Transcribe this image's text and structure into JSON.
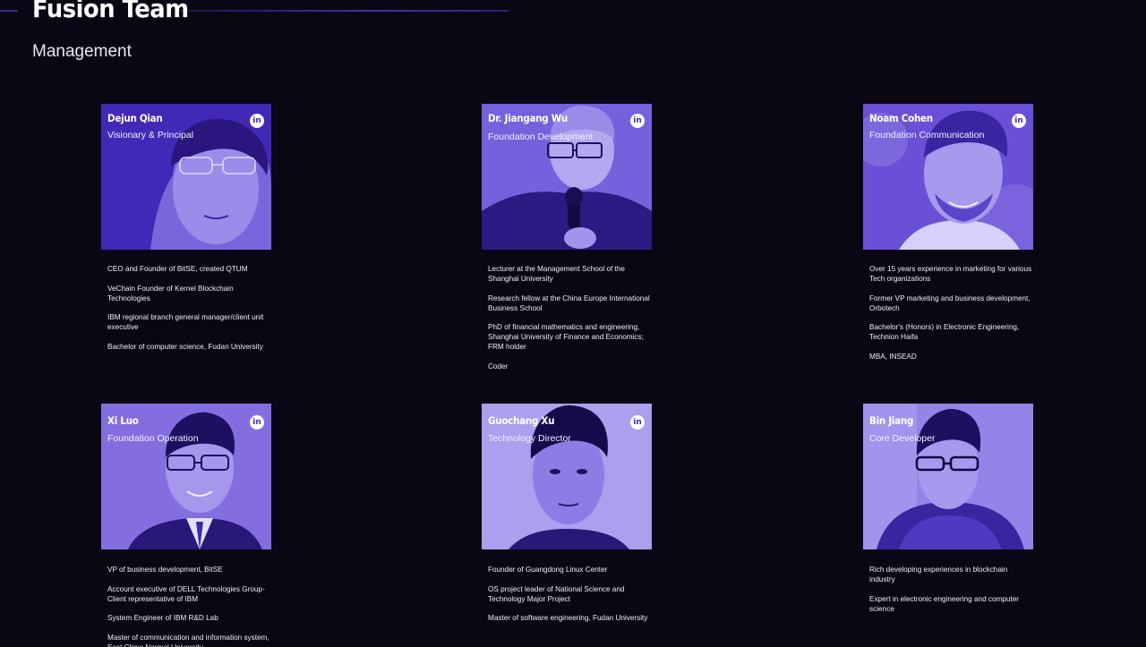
{
  "header": {
    "title": "Fusion Team",
    "section": "Management"
  },
  "colors": {
    "background": "#0b0614",
    "photo_tint": "#5a3fd0",
    "accent_line": "#3d33a8"
  },
  "members": [
    {
      "name": "Dejun Qian",
      "role": "Visionary & Principal",
      "linkedin": "in",
      "bio": [
        "CEO and Founder of BitSE, created QTUM",
        " VeChain Founder of Kernel Blockchain Technologies",
        "IBM regional branch general manager/client unit executive",
        "Bachelor of computer science, Fudan University"
      ]
    },
    {
      "name": "Dr. Jiangang Wu",
      "role": "Foundation Development",
      "linkedin": "in",
      "bio": [
        "Lecturer at the Management School of the Shanghai University",
        "Research fellow at the China Europe International Business School",
        "PhD of financial mathematics and engineering, Shanghai University of Finance and Economics; FRM holder",
        "Coder"
      ]
    },
    {
      "name": "Noam Cohen",
      "role": "Foundation Communication",
      "linkedin": "in",
      "bio": [
        "Over 15 years experience in marketing for various Tech organizations",
        "Former VP marketing and business development, Orbotech",
        "Bachelor's (Honors) in Electronic Engineering, Technion Haifa",
        "MBA, INSEAD"
      ]
    },
    {
      "name": "Xi Luo",
      "role": "Foundation Operation",
      "linkedin": "in",
      "bio": [
        "VP of business development, BitSE",
        "Account executive of DELL Technologies Group-Client representative of IBM",
        "System Engineer of IBM R&D Lab",
        "Master of communication and information system, East China Normal University"
      ]
    },
    {
      "name": "Guochang Xu",
      "role": "Technology Director",
      "linkedin": "in",
      "bio": [
        "Founder of Guangdong Linux Center",
        "OS project leader of National Science and Technology Major Project",
        "Master of software engineering, Fudan University"
      ]
    },
    {
      "name": "Bin Jiang",
      "role": "Core Developer",
      "linkedin": "",
      "bio": [
        "Rich developing experiences in blockchain industry",
        "Expert in electronic engineering and computer science"
      ]
    }
  ]
}
